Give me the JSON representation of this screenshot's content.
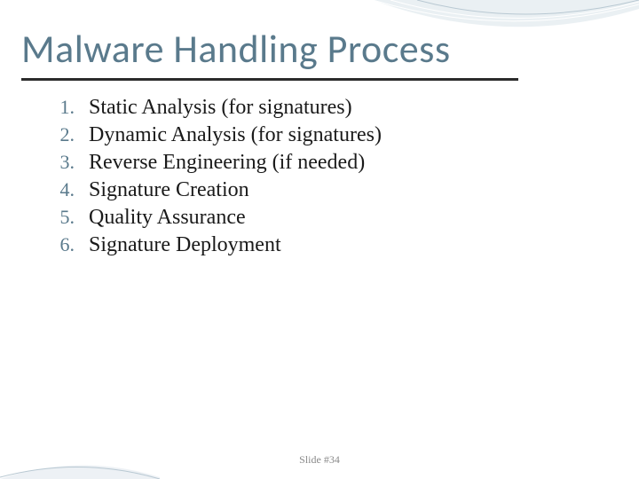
{
  "title": "Malware Handling Process",
  "items": [
    {
      "n": "1.",
      "text": "Static Analysis (for signatures)"
    },
    {
      "n": "2.",
      "text": "Dynamic Analysis (for signatures)"
    },
    {
      "n": "3.",
      "text": "Reverse Engineering (if needed)"
    },
    {
      "n": "4.",
      "text": "Signature Creation"
    },
    {
      "n": "5.",
      "text": "Quality Assurance"
    },
    {
      "n": "6.",
      "text": "Signature Deployment"
    }
  ],
  "footer": "Slide #34",
  "colors": {
    "accent": "#5a7a8c",
    "underline": "#2b2b2b"
  }
}
